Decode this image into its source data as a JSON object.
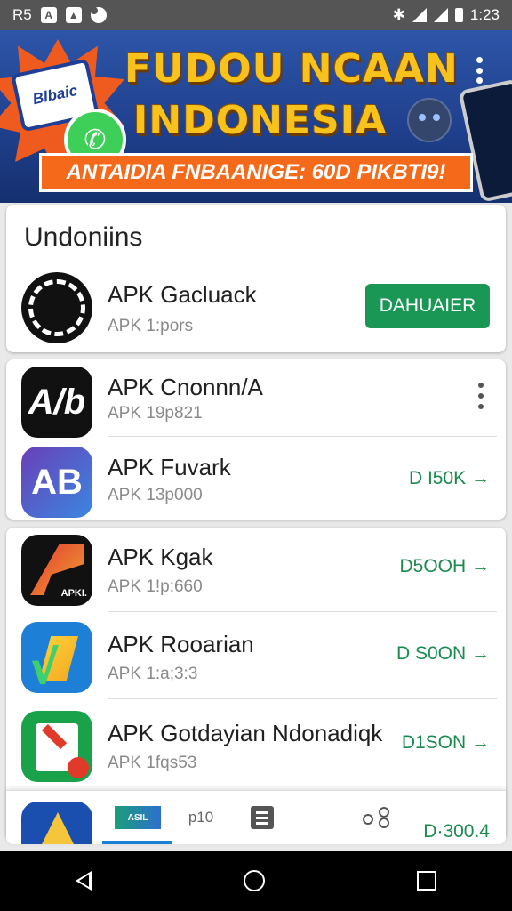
{
  "status_bar": {
    "left_text": "R5",
    "time": "1:23"
  },
  "banner": {
    "badge_text": "Blbaic",
    "title_line1": "FUDOU NCAAN",
    "title_line2": "INDONESIA",
    "ribbon_text": "ANTAIDIA FNBAANIGE: 60D PIKBTI9!"
  },
  "featured": {
    "section_title": "Undoniins",
    "app": {
      "name": "APK Gacluack",
      "sub": "APK 1:pors",
      "button_label": "DAHUAIER"
    }
  },
  "group2": [
    {
      "name": "APK Cnonnn/A",
      "sub": "APK 19p821",
      "icon_text": "A/b"
    },
    {
      "name": "APK Fuvark",
      "sub": "APK 13p000",
      "icon_text": "AB",
      "link": "D I50K →"
    }
  ],
  "group3": [
    {
      "name": "APK Kgak",
      "sub": "APK 1!p:660",
      "icon_text": "APKI.",
      "link": "D5OOH →"
    },
    {
      "name": "APK Rooarian",
      "sub": "APK 1:a;3:3",
      "link": "D S0ON →"
    },
    {
      "name": "APK Gotdayian Ndonadiqk",
      "sub": "APK 1fqs53",
      "link": "D1SON →"
    }
  ],
  "tabbar": {
    "tab1_img_text": "ASIL",
    "tab2_label": "p10",
    "last_link": "D·300.4"
  }
}
